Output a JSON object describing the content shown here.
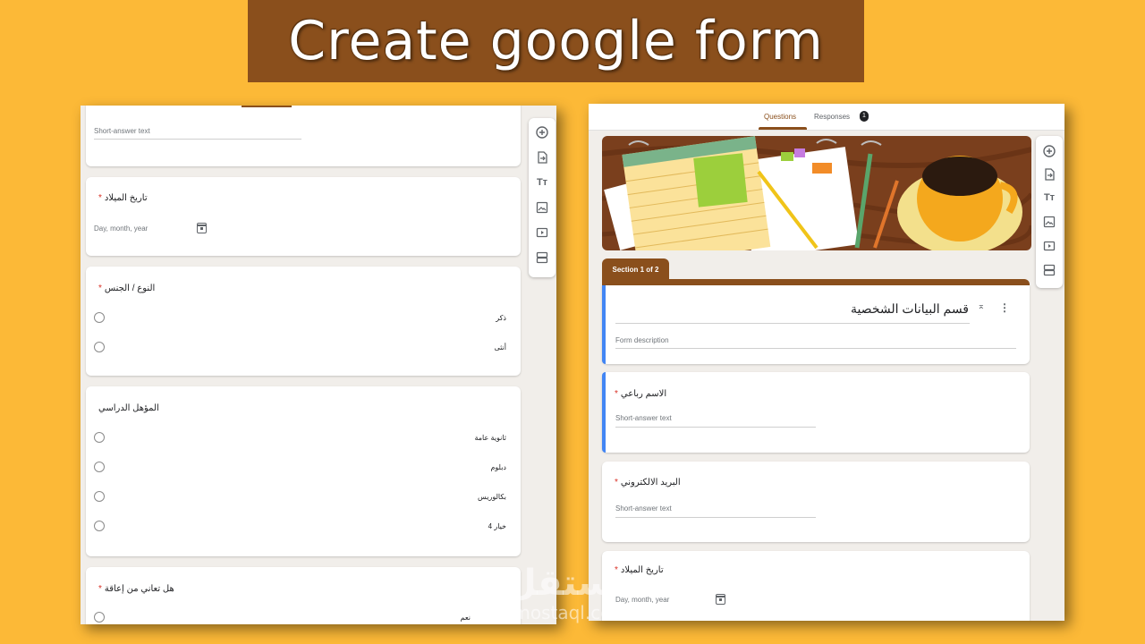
{
  "banner": {
    "title": "Create google form"
  },
  "colors": {
    "background": "#fcb937",
    "brand_brown": "#8a4f1c",
    "accent_blue": "#4285f4",
    "required_red": "#d93025"
  },
  "left_form": {
    "card1": {
      "hint": "Short-answer text"
    },
    "card2": {
      "title": "تاريخ الميلاد",
      "required": "*",
      "hint": "Day, month, year",
      "icon": "calendar-icon"
    },
    "card3": {
      "title": "النوع / الجنس",
      "required": "*",
      "options": [
        "ذكر",
        "أنثى"
      ]
    },
    "card4": {
      "title": "المؤهل الدراسي",
      "options": [
        "ثانوية عامة",
        "دبلوم",
        "بكالوريس",
        "خيار 4"
      ]
    },
    "card5": {
      "title": "هل تعاني من إعاقة",
      "required": "*",
      "options": [
        "نعم"
      ]
    },
    "toolbar": [
      "add-question-icon",
      "import-questions-icon",
      "add-title-icon",
      "add-image-icon",
      "add-video-icon",
      "add-section-icon"
    ]
  },
  "right_form": {
    "tabs": {
      "questions": "Questions",
      "responses": "Responses",
      "responses_count": "1"
    },
    "section_label": "Section 1 of 2",
    "section_title": "قسم البيانات الشخصية",
    "form_description": "Form description",
    "q1": {
      "title": "الاسم رباعي",
      "required": "*",
      "hint": "Short-answer text"
    },
    "q2": {
      "title": "البريد الالكتروني",
      "required": "*",
      "hint": "Short-answer text"
    },
    "q3": {
      "title": "تاريخ الميلاد",
      "required": "*",
      "hint": "Day, month, year",
      "icon": "calendar-icon"
    },
    "toolbar": [
      "add-question-icon",
      "import-questions-icon",
      "add-title-icon",
      "add-image-icon",
      "add-video-icon",
      "add-section-icon"
    ]
  },
  "watermark": {
    "main": "مستقل",
    "sub": "mostaql.com"
  }
}
